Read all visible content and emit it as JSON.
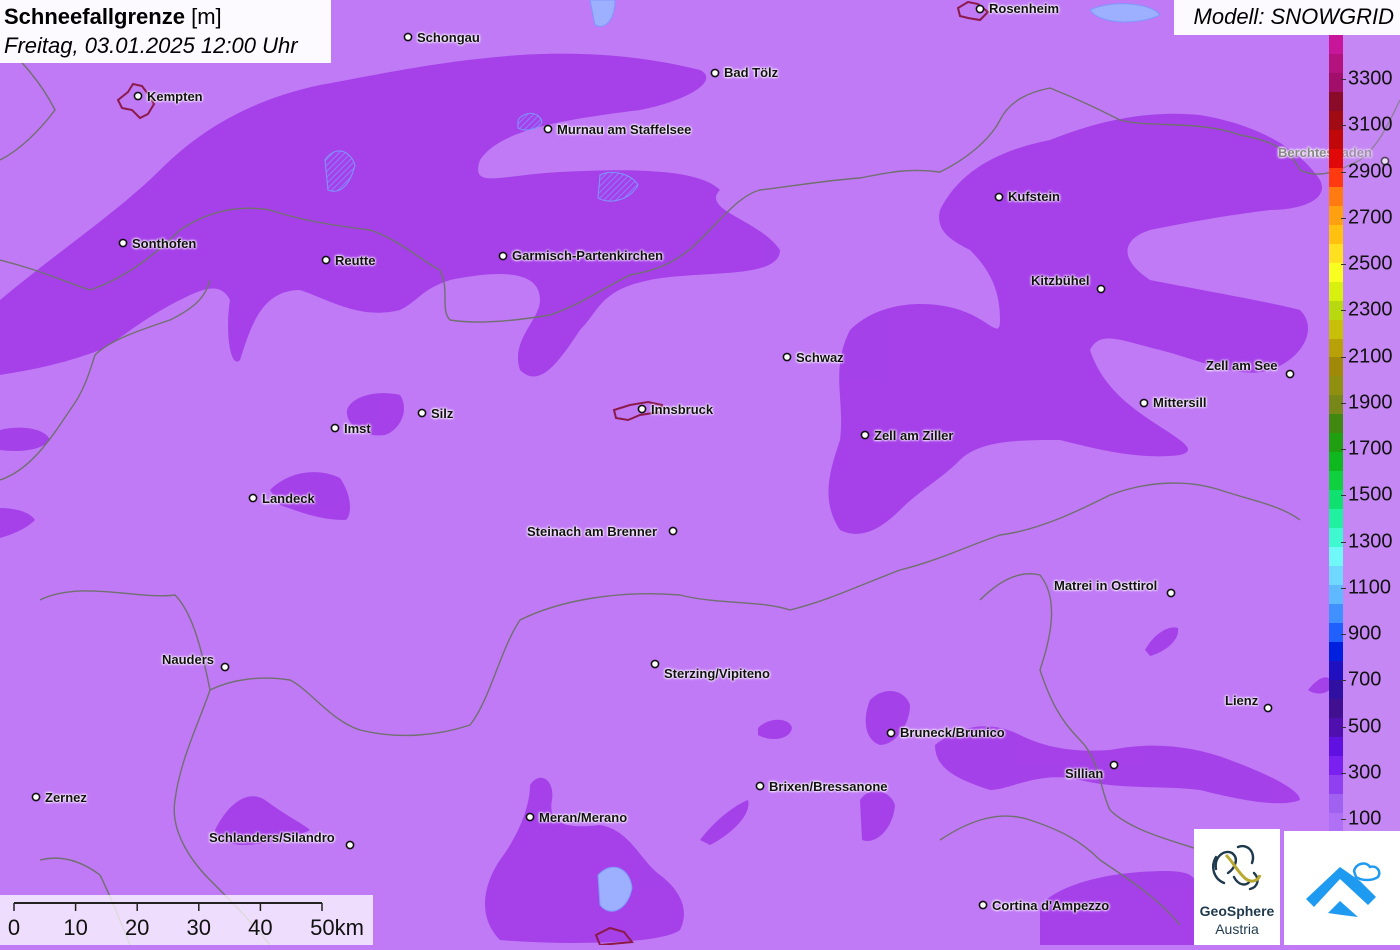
{
  "title": {
    "bold": "Schneefallgrenze",
    "unit": "[m]",
    "datetime": "Freitag, 03.01.2025 12:00 Uhr"
  },
  "model": "Modell: SNOWGRID",
  "colors": {
    "base": "#c07af5",
    "dark": "#a43ee8",
    "border": "#707070",
    "city_outline": "#8b1a4a",
    "water": "#9cb0ff"
  },
  "legend": {
    "labels": [
      "3300",
      "3100",
      "2900",
      "2700",
      "2500",
      "2300",
      "2100",
      "1900",
      "1700",
      "1500",
      "1300",
      "1100",
      "900",
      "700",
      "500",
      "300",
      "100"
    ],
    "colors": [
      "#c8169a",
      "#b4127e",
      "#a20f6a",
      "#8a0b28",
      "#a00b14",
      "#c0080a",
      "#e00808",
      "#ff3a10",
      "#ff7a10",
      "#ffa010",
      "#ffc010",
      "#ffe020",
      "#f8ff20",
      "#d8f010",
      "#b8d810",
      "#c8c008",
      "#b8a008",
      "#a08808",
      "#909010",
      "#788818",
      "#408810",
      "#20a010",
      "#10b820",
      "#10d040",
      "#10e070",
      "#20f0a0",
      "#40f8d0",
      "#70f8f8",
      "#70d8ff",
      "#60b8ff",
      "#4090ff",
      "#2060ff",
      "#0020e0",
      "#2010c0",
      "#3010a0",
      "#401090",
      "#5010b0",
      "#6010e0",
      "#7a20f0",
      "#9040f0",
      "#a060f0",
      "#b070f5"
    ]
  },
  "cities": [
    {
      "name": "Rosenheim",
      "dot": [
        980,
        9
      ],
      "lbl": [
        989,
        2
      ],
      "outline": true
    },
    {
      "name": "Schongau",
      "dot": [
        408,
        37
      ],
      "lbl": [
        417,
        31
      ]
    },
    {
      "name": "Bad Tölz",
      "dot": [
        715,
        73
      ],
      "lbl": [
        724,
        66
      ]
    },
    {
      "name": "Kempten",
      "dot": [
        138,
        96
      ],
      "lbl": [
        147,
        90
      ],
      "outline": true
    },
    {
      "name": "Murnau am Staffelsee",
      "dot": [
        548,
        129
      ],
      "lbl": [
        557,
        123
      ]
    },
    {
      "name": "Berchtesgaden",
      "dot": [
        1385,
        161
      ],
      "lbl": [
        1278,
        146
      ]
    },
    {
      "name": "Kufstein",
      "dot": [
        999,
        197
      ],
      "lbl": [
        1008,
        190
      ]
    },
    {
      "name": "Sonthofen",
      "dot": [
        123,
        243
      ],
      "lbl": [
        132,
        237
      ]
    },
    {
      "name": "Reutte",
      "dot": [
        326,
        260
      ],
      "lbl": [
        335,
        254
      ]
    },
    {
      "name": "Garmisch-Partenkirchen",
      "dot": [
        503,
        256
      ],
      "lbl": [
        512,
        249
      ]
    },
    {
      "name": "Kitzbühel",
      "dot": [
        1101,
        289
      ],
      "lbl": [
        1031,
        274
      ]
    },
    {
      "name": "Schwaz",
      "dot": [
        787,
        357
      ],
      "lbl": [
        796,
        351
      ]
    },
    {
      "name": "Zell am See",
      "dot": [
        1290,
        374
      ],
      "lbl": [
        1206,
        359
      ]
    },
    {
      "name": "Mittersill",
      "dot": [
        1144,
        403
      ],
      "lbl": [
        1153,
        396
      ]
    },
    {
      "name": "Silz",
      "dot": [
        422,
        413
      ],
      "lbl": [
        431,
        407
      ]
    },
    {
      "name": "Innsbruck",
      "dot": [
        642,
        409
      ],
      "lbl": [
        651,
        403
      ],
      "outline": true
    },
    {
      "name": "Imst",
      "dot": [
        335,
        428
      ],
      "lbl": [
        344,
        422
      ]
    },
    {
      "name": "Zell am Ziller",
      "dot": [
        865,
        435
      ],
      "lbl": [
        874,
        429
      ]
    },
    {
      "name": "Landeck",
      "dot": [
        253,
        498
      ],
      "lbl": [
        262,
        492
      ]
    },
    {
      "name": "Steinach am Brenner",
      "dot": [
        673,
        531
      ],
      "lbl": [
        527,
        525
      ]
    },
    {
      "name": "Matrei in Osttirol",
      "dot": [
        1171,
        593
      ],
      "lbl": [
        1054,
        579
      ]
    },
    {
      "name": "Nauders",
      "dot": [
        225,
        667
      ],
      "lbl": [
        162,
        653
      ]
    },
    {
      "name": "Sterzing/Vipiteno",
      "dot": [
        655,
        664
      ],
      "lbl": [
        664,
        667
      ]
    },
    {
      "name": "Lienz",
      "dot": [
        1268,
        708
      ],
      "lbl": [
        1225,
        694
      ]
    },
    {
      "name": "Bruneck/Brunico",
      "dot": [
        891,
        733
      ],
      "lbl": [
        900,
        726
      ]
    },
    {
      "name": "Sillian",
      "dot": [
        1114,
        765
      ],
      "lbl": [
        1065,
        767
      ]
    },
    {
      "name": "Brixen/Bressanone",
      "dot": [
        760,
        786
      ],
      "lbl": [
        769,
        780
      ]
    },
    {
      "name": "Zernez",
      "dot": [
        36,
        797
      ],
      "lbl": [
        45,
        791
      ]
    },
    {
      "name": "Meran/Merano",
      "dot": [
        530,
        817
      ],
      "lbl": [
        539,
        811
      ]
    },
    {
      "name": "Schlanders/Silandro",
      "dot": [
        350,
        845
      ],
      "lbl": [
        209,
        831
      ]
    },
    {
      "name": "Cortina d'Ampezzo",
      "dot": [
        983,
        905
      ],
      "lbl": [
        992,
        899
      ]
    }
  ],
  "scale": {
    "labels": [
      "0",
      "10",
      "20",
      "30",
      "40",
      "50km"
    ]
  },
  "logos": {
    "geosphere_name": "GeoSphere",
    "geosphere_sub": "Austria"
  }
}
